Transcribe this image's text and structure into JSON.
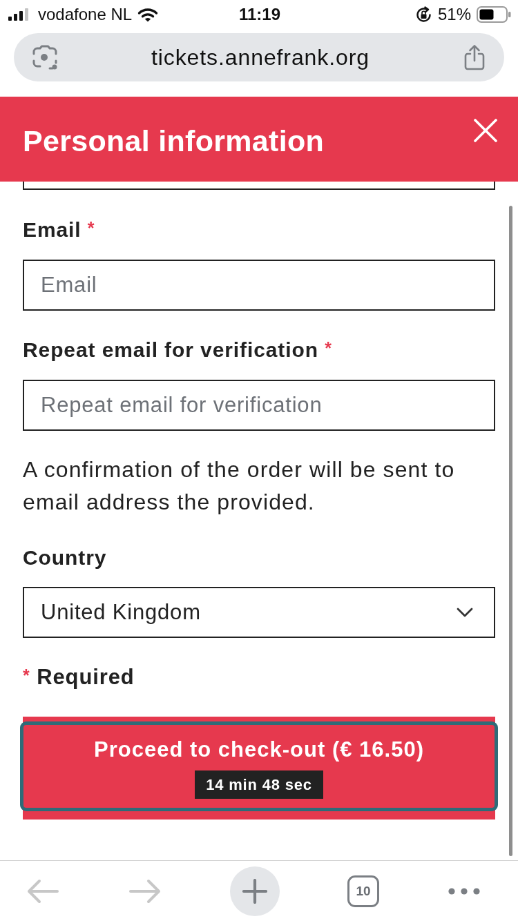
{
  "status_bar": {
    "carrier": "vodafone NL",
    "time": "11:19",
    "battery": "51%"
  },
  "address_bar": {
    "url": "tickets.annefrank.org"
  },
  "header": {
    "title": "Personal information"
  },
  "form": {
    "items": [
      {
        "kind": "clipped"
      },
      {
        "kind": "text",
        "label": "Email",
        "required_mark": "*",
        "placeholder": "Email"
      },
      {
        "kind": "text",
        "label": "Repeat email for verification",
        "required_mark": "*",
        "placeholder": "Repeat email for verification"
      },
      {
        "kind": "note",
        "text": "A confirmation of the order will be sent to email address the provided."
      },
      {
        "kind": "select",
        "label": "Country",
        "value": "United Kingdom"
      }
    ],
    "required_note": {
      "mark": "*",
      "text": "Required"
    }
  },
  "checkout": {
    "label": "Proceed to check-out (€ 16.50)",
    "timer": "14 min 48 sec",
    "focused": true
  },
  "toolbar": {
    "buttons": [
      {
        "kind": "back",
        "disabled": true
      },
      {
        "kind": "forward",
        "disabled": true
      },
      {
        "kind": "new_tab",
        "disabled": false
      },
      {
        "kind": "tabs",
        "count": "10",
        "disabled": false
      },
      {
        "kind": "more",
        "disabled": false
      }
    ]
  }
}
